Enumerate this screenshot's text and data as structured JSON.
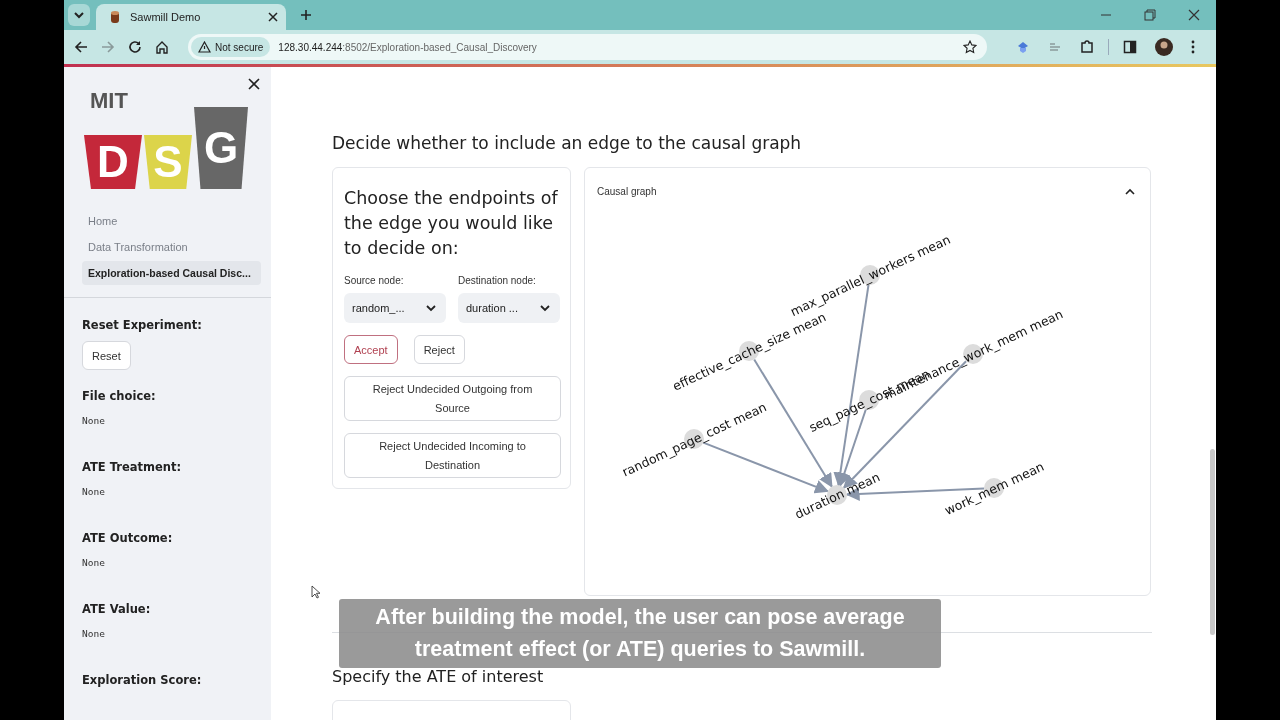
{
  "browser": {
    "tab_title": "Sawmill Demo",
    "security": "Not secure",
    "host": "128.30.44.244",
    "path": ":8502/Exploration-based_Causal_Discovery"
  },
  "sidebar": {
    "logo": {
      "top": "MIT",
      "letters": [
        "D",
        "S",
        "G"
      ]
    },
    "nav": [
      {
        "label": "Home",
        "selected": false
      },
      {
        "label": "Data Transformation",
        "selected": false
      },
      {
        "label": "Exploration-based Causal Disc...",
        "selected": true
      }
    ],
    "sections": [
      {
        "kind": "button",
        "label": "Reset Experiment:",
        "button": "Reset"
      },
      {
        "kind": "value",
        "label": "File choice:",
        "value": "None"
      },
      {
        "kind": "value",
        "label": "ATE Treatment:",
        "value": "None"
      },
      {
        "kind": "value",
        "label": "ATE Outcome:",
        "value": "None"
      },
      {
        "kind": "value",
        "label": "ATE Value:",
        "value": "None"
      },
      {
        "kind": "heading",
        "label": "Exploration Score:"
      }
    ]
  },
  "main": {
    "heading": "Decide whether to include an edge to the causal graph",
    "edge_panel": {
      "title": "Choose the endpoints of the edge you would like to decide on:",
      "selects": [
        {
          "label": "Source node:",
          "value": "random_..."
        },
        {
          "label": "Destination node:",
          "value": "duration ..."
        }
      ],
      "buttons": [
        {
          "label": "Accept",
          "kind": "primary"
        },
        {
          "label": "Reject",
          "kind": "secondary"
        }
      ],
      "wide_buttons": [
        "Reject Undecided Outgoing from Source",
        "Reject Undecided Incoming to Destination"
      ]
    },
    "graph": {
      "title": "Causal graph",
      "expanded": true,
      "nodes": [
        {
          "label": "max_parallel_workers mean",
          "kind": "cause"
        },
        {
          "label": "effective_cache_size mean",
          "kind": "cause"
        },
        {
          "label": "maintenance_work_mem mean",
          "kind": "cause"
        },
        {
          "label": "seq_page_cost mean",
          "kind": "cause"
        },
        {
          "label": "random_page_cost mean",
          "kind": "cause"
        },
        {
          "label": "duration mean",
          "kind": "effect"
        },
        {
          "label": "work_mem mean",
          "kind": "cause"
        }
      ]
    },
    "ate_heading": "Specify the ATE of interest"
  },
  "caption": "After building the model, the user can pose average treatment effect (or ATE) queries to Sawmill."
}
